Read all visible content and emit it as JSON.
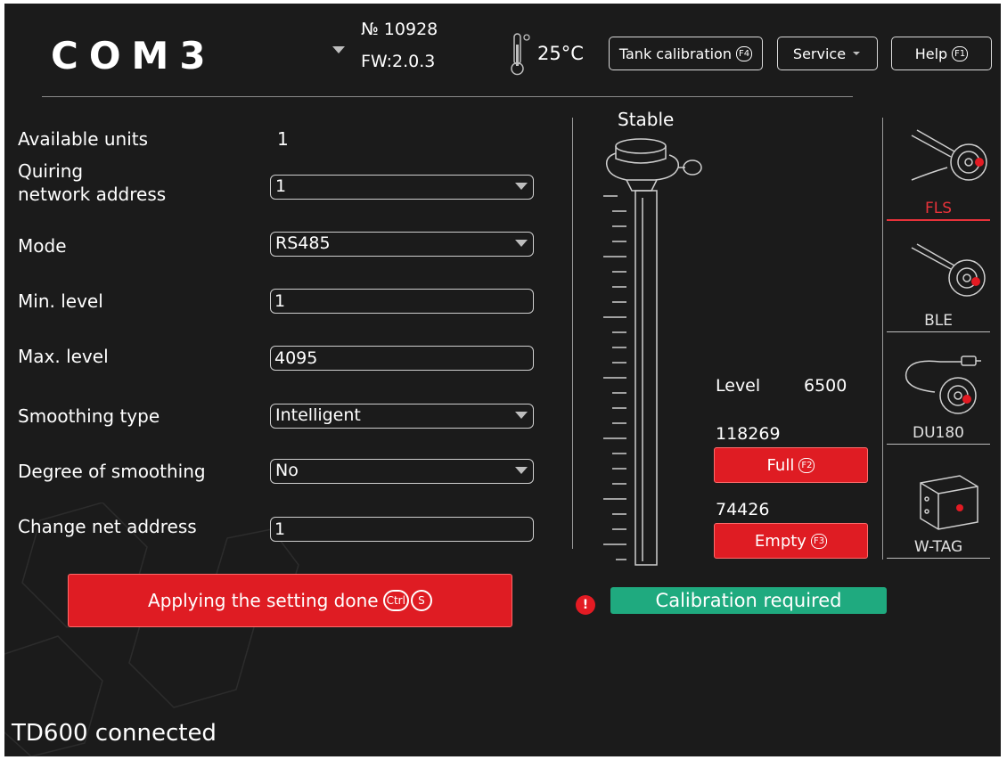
{
  "header": {
    "logo": "COM3",
    "device_number_label": "№ 10928",
    "firmware": "FW:2.0.3",
    "temperature": "25°C",
    "tank_calibration_label": "Tank calibration",
    "tank_calibration_key": "F4",
    "service_label": "Service",
    "help_label": "Help",
    "help_key": "F1"
  },
  "form": {
    "available_units_label": "Available units",
    "available_units_value": "1",
    "quiring_label_line1": "Quiring",
    "quiring_label_line2": "network address",
    "quiring_value": "1",
    "mode_label": "Mode",
    "mode_value": "RS485",
    "min_level_label": "Min. level",
    "min_level_value": "1",
    "max_level_label": "Max. level",
    "max_level_value": "4095",
    "smoothing_type_label": "Smoothing type",
    "smoothing_type_value": "Intelligent",
    "degree_label": "Degree of smoothing",
    "degree_value": "No",
    "change_net_label": "Change net address",
    "change_net_value": "1",
    "apply_label": "Applying the setting done",
    "apply_key1": "Ctrl",
    "apply_key2": "S"
  },
  "probe": {
    "stable_label": "Stable",
    "level_label": "Level",
    "level_value": "6500",
    "full_value": "118269",
    "full_label": "Full",
    "full_key": "F2",
    "empty_value": "74426",
    "empty_label": "Empty",
    "empty_key": "F3",
    "warning_symbol": "!",
    "calibration_status": "Calibration required"
  },
  "devices": [
    {
      "name": "FLS",
      "icon": "fls-sensor-icon",
      "active": true
    },
    {
      "name": "BLE",
      "icon": "ble-sensor-icon",
      "active": false
    },
    {
      "name": "DU180",
      "icon": "du180-sensor-icon",
      "active": false
    },
    {
      "name": "W-TAG",
      "icon": "wtag-sensor-icon",
      "active": false
    }
  ],
  "status_bar": {
    "text": "TD600 connected"
  },
  "colors": {
    "background": "#1b1b1b",
    "accent_red": "#df1c23",
    "status_green": "#1faa7f"
  }
}
